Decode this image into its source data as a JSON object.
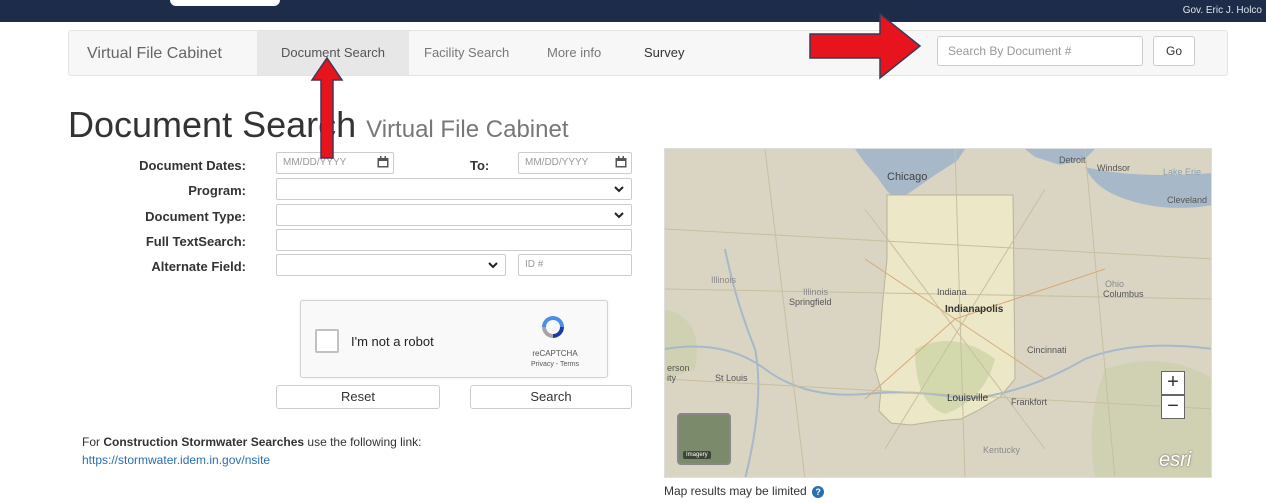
{
  "header": {
    "governor_text": "Gov. Eric J. Holco"
  },
  "navbar": {
    "brand": "Virtual File Cabinet",
    "items": [
      {
        "label": "Document Search",
        "active": true
      },
      {
        "label": "Facility Search"
      },
      {
        "label": "More info"
      },
      {
        "label": "Survey"
      }
    ],
    "search_placeholder": "Search By Document #",
    "go_label": "Go"
  },
  "page": {
    "title": "Document Search",
    "subtitle": "Virtual File Cabinet"
  },
  "form": {
    "document_dates_label": "Document Dates:",
    "date_placeholder": "MM/DD/YYYY",
    "to_label": "To:",
    "program_label": "Program:",
    "document_type_label": "Document Type:",
    "full_text_label": "Full TextSearch:",
    "alternate_field_label": "Alternate Field:",
    "id_placeholder": "ID #",
    "captcha": {
      "label": "I'm not a robot",
      "brand": "reCAPTCHA",
      "links": "Privacy - Terms"
    },
    "reset_label": "Reset",
    "search_label": "Search"
  },
  "note": {
    "prefix": "For ",
    "bold": "Construction Stormwater Searches",
    "suffix": " use the following link:",
    "link": "https://stormwater.idem.in.gov/nsite"
  },
  "map": {
    "labels": {
      "chicago": "Chicago",
      "detroit": "Detroit",
      "windsor": "Windsor",
      "lake_erie": "Lake Erie",
      "cleveland": "Cleveland",
      "illinois": "Illinois",
      "illinois2": "Illinois",
      "springfield": "Springfield",
      "indiana": "Indiana",
      "indianapolis": "Indianapolis",
      "ohio": "Ohio",
      "columbus": "Columbus",
      "cincinnati": "Cincinnati",
      "st_louis": "St Louis",
      "louisville": "Louisville",
      "frankfort": "Frankfort",
      "kentucky": "Kentucky",
      "jefferson": "erson",
      "jefferson2": "ity",
      "esri": "esri",
      "imagery": "Imagery"
    },
    "zoom_in": "+",
    "zoom_out": "−",
    "note": "Map results may be limited"
  },
  "colors": {
    "topbar": "#1d2d49",
    "arrow": "#e8141d",
    "link": "#2a6fb0"
  }
}
